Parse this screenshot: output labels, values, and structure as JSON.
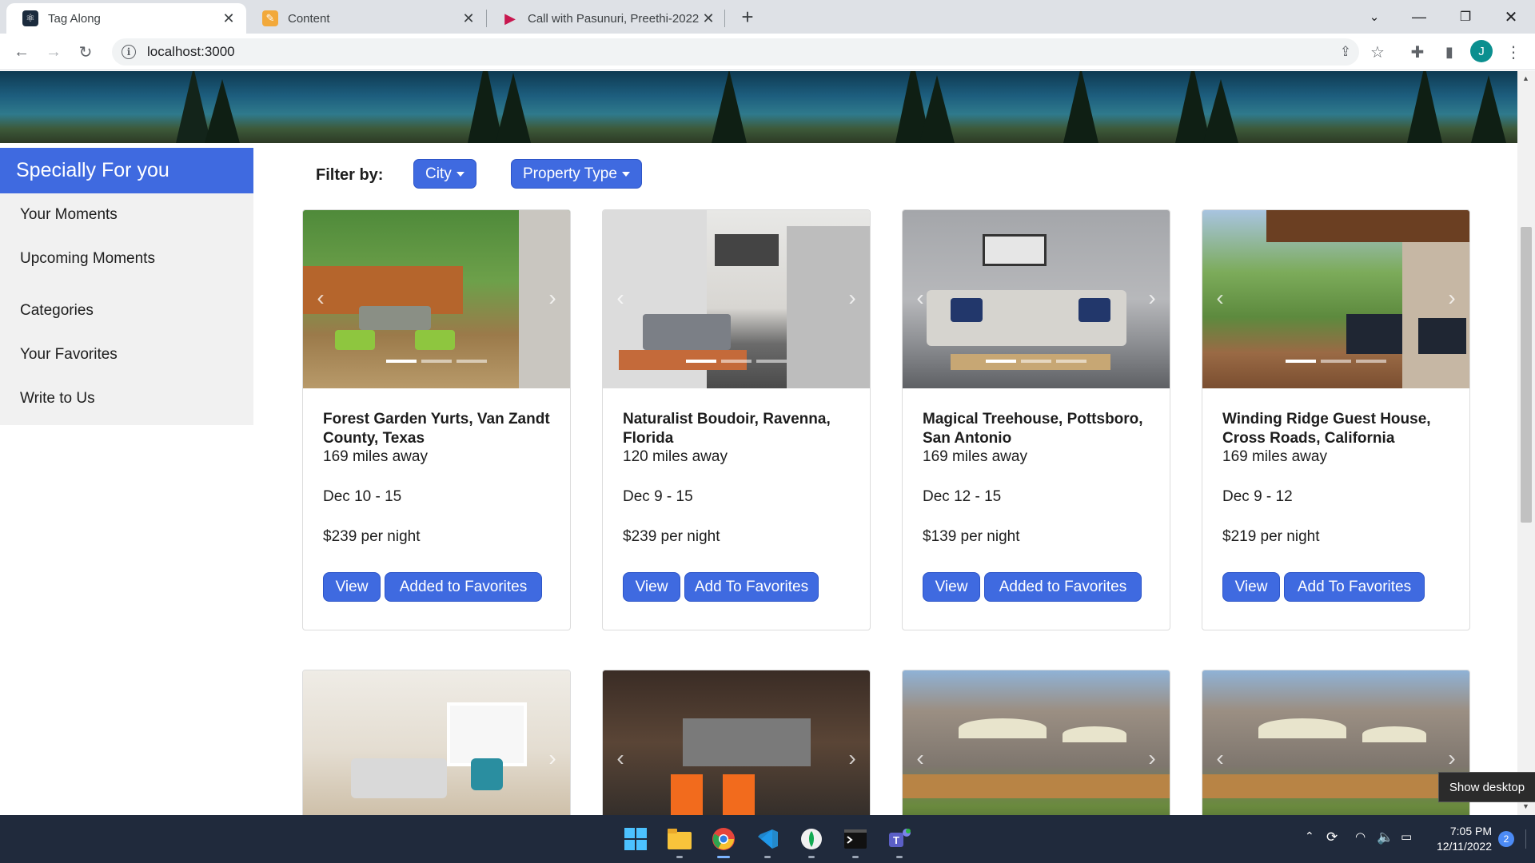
{
  "browser": {
    "tabs": [
      {
        "title": "Tag Along",
        "active": true
      },
      {
        "title": "Content",
        "active": false
      },
      {
        "title": "Call with Pasunuri, Preethi-2022",
        "active": false
      }
    ],
    "url": "localhost:3000",
    "profile_initial": "J"
  },
  "sidebar": {
    "heading": "Specially For you",
    "items": [
      "Your Moments",
      "Upcoming Moments",
      "Categories",
      "Your Favorites",
      "Write to Us"
    ]
  },
  "filter": {
    "label": "Filter by:",
    "city": "City",
    "property_type": "Property Type"
  },
  "cards": [
    {
      "name": "Forest Garden Yurts, Van Zandt County, Texas",
      "distance": "169 miles away",
      "dates": "Dec 10 - 15",
      "price": "$239 per night",
      "view": "View",
      "fav": "Added to Favorites"
    },
    {
      "name": "Naturalist Boudoir, Ravenna, Florida",
      "distance": "120 miles away",
      "dates": "Dec 9 - 15",
      "price": "$239 per night",
      "view": "View",
      "fav": "Add To Favorites"
    },
    {
      "name": "Magical Treehouse, Pottsboro, San Antonio",
      "distance": "169 miles away",
      "dates": "Dec 12 - 15",
      "price": "$139 per night",
      "view": "View",
      "fav": "Added to Favorites"
    },
    {
      "name": "Winding Ridge Guest House, Cross Roads, California",
      "distance": "169 miles away",
      "dates": "Dec 9 - 12",
      "price": "$219 per night",
      "view": "View",
      "fav": "Add To Favorites"
    }
  ],
  "taskbar": {
    "time": "7:05 PM",
    "date": "12/11/2022",
    "notification_count": "2",
    "tooltip": "Show desktop"
  },
  "colors": {
    "accent": "#3f6ae0",
    "sidebar_bg": "#f1f1f1",
    "taskbar_bg": "#202a3c"
  }
}
